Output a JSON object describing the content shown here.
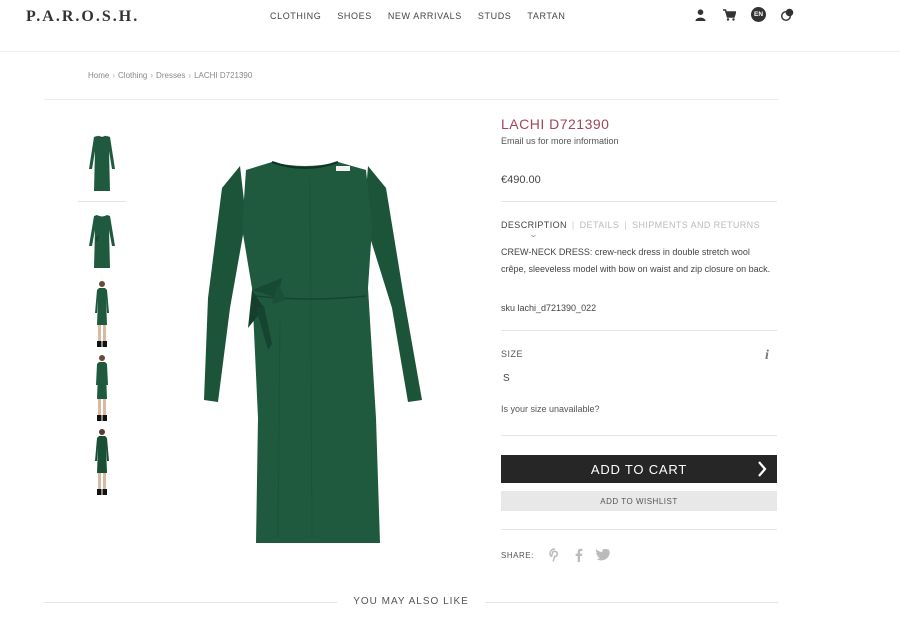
{
  "header": {
    "logo": "P.A.R.O.S.H.",
    "nav": [
      "CLOTHING",
      "SHOES",
      "NEW ARRIVALS",
      "STUDS",
      "TARTAN"
    ],
    "language": "EN",
    "icons": [
      "user-icon",
      "cart-icon",
      "language-icon",
      "currency-icon"
    ]
  },
  "breadcrumb": [
    "Home",
    "Clothing",
    "Dresses",
    "LACHI D721390"
  ],
  "product": {
    "title": "LACHI D721390",
    "email_note": "Email us for more information",
    "price": "€490.00",
    "tabs": [
      "DESCRIPTION",
      "DETAILS",
      "SHIPMENTS AND RETURNS"
    ],
    "active_tab": "DESCRIPTION",
    "description": "CREW-NECK DRESS: crew-neck dress in double stretch wool crêpe, sleeveless model with bow on waist and zip closure on back.",
    "sku": "sku lachi_d721390_022",
    "size_label": "SIZE",
    "size_options": [
      "S"
    ],
    "size_unavailable": "Is your size unavailable?",
    "add_to_cart": "ADD TO CART",
    "add_to_wishlist": "ADD TO WISHLIST",
    "share_label": "SHARE:",
    "share_icons": [
      "pinterest-icon",
      "facebook-icon",
      "twitter-icon"
    ]
  },
  "colors": {
    "title": "#a0475a",
    "dress": "#1f5a3e",
    "cart_button": "#262626",
    "wishlist_button": "#e8e8e8"
  },
  "recommendations": {
    "heading": "YOU MAY ALSO LIKE"
  }
}
